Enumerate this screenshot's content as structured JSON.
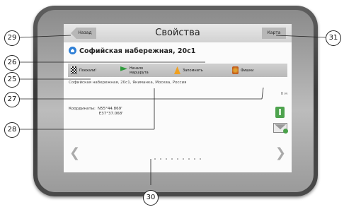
{
  "screen": {
    "back_label": "Назад",
    "title": "Свойства",
    "map_label": "Карта",
    "address_title": "Софийская набережная, 20с1",
    "actions": [
      {
        "label": "Поехали!",
        "icon": "checkered-flag-icon"
      },
      {
        "label": "Начало\nмаршрута",
        "icon": "route-start-flag-icon"
      },
      {
        "label": "Запомнить",
        "icon": "save-pin-icon"
      },
      {
        "label": "Фишки",
        "icon": "favorites-icon"
      }
    ],
    "address_line": "Софийская набережная, 20с1, Якиманка, Москва, Россия",
    "distance": "0 м",
    "coords_label": "Координаты:",
    "coords_value": "N55°44.869'\n E37°37.068'",
    "prev_arrow": "❮",
    "next_arrow": "❯",
    "page_dots": 9
  },
  "callouts": [
    "29",
    "26",
    "25",
    "27",
    "28",
    "30",
    "31"
  ]
}
